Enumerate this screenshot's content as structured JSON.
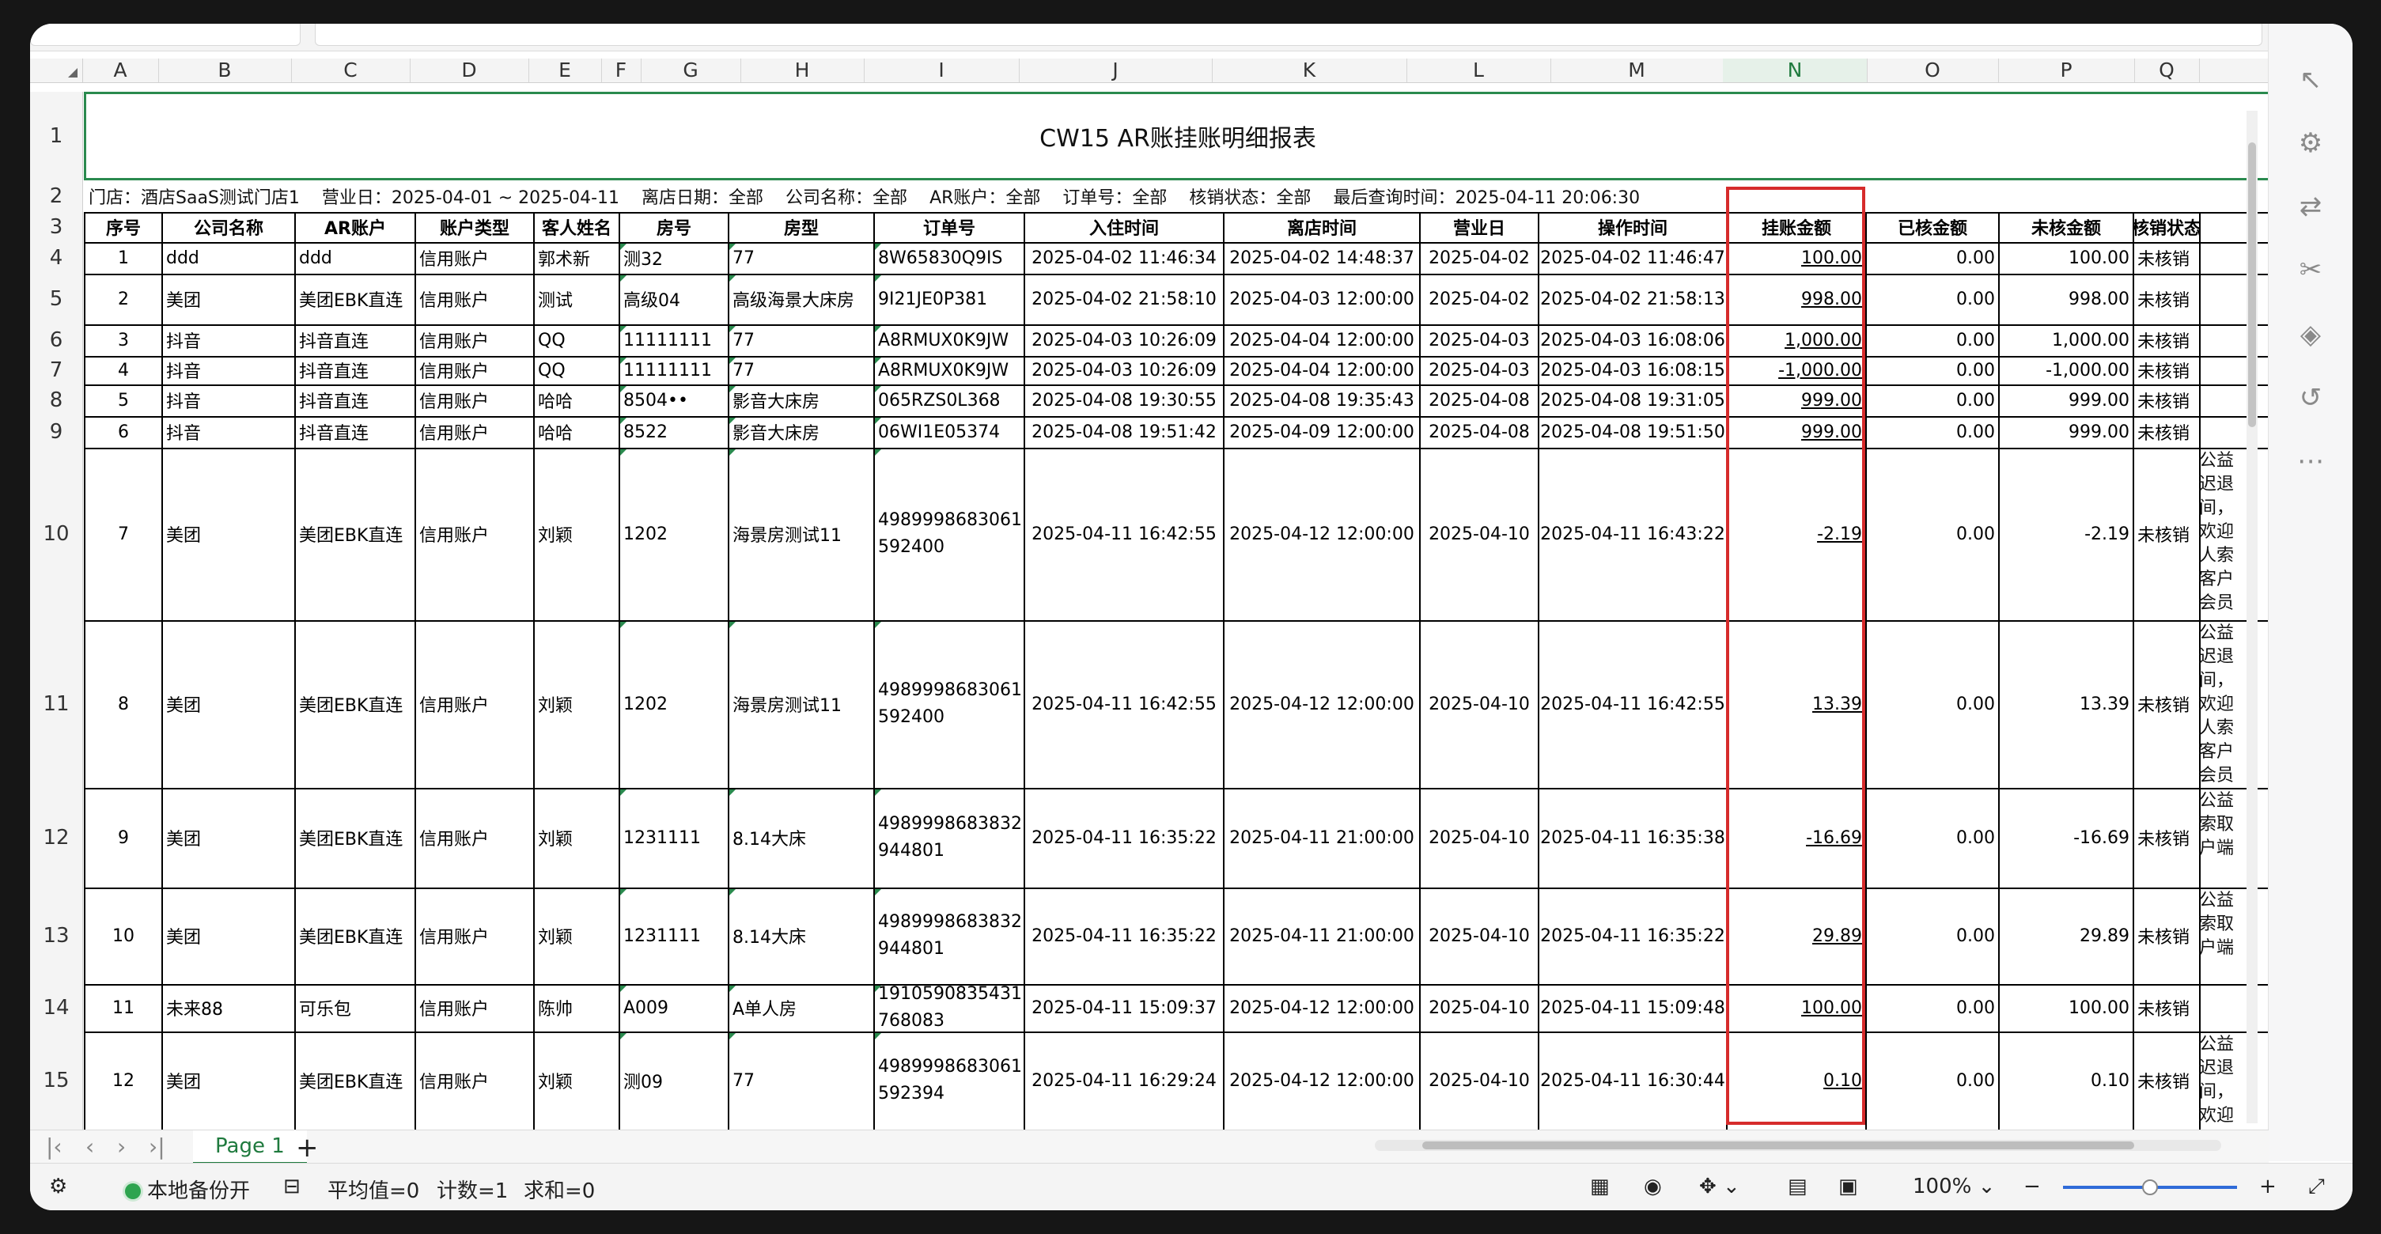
{
  "report_title": "CW15 AR账挂账明细报表",
  "meta": {
    "store": "门店：酒店SaaS测试门店1",
    "business_date": "营业日：2025-04-01 ~ 2025-04-11",
    "checkout_date": "离店日期：全部",
    "company": "公司名称：全部",
    "ar_account": "AR账户：全部",
    "order_no": "订单号：全部",
    "status": "核销状态：全部",
    "last_query": "最后查询时间：2025-04-11 20:06:30"
  },
  "columns": [
    "A",
    "B",
    "C",
    "D",
    "E",
    "F",
    "G",
    "H",
    "I",
    "J",
    "K",
    "L",
    "M",
    "N",
    "O",
    "P",
    "Q"
  ],
  "headers": [
    "序号",
    "公司名称",
    "AR账户",
    "账户类型",
    "客人姓名",
    "房号",
    "房型",
    "订单号",
    "入住时间",
    "离店时间",
    "营业日",
    "操作时间",
    "挂账金额",
    "已核金额",
    "未核金额",
    "核销状态"
  ],
  "rows": [
    {
      "n": "4",
      "seq": "1",
      "company": "ddd",
      "ar": "ddd",
      "type": "信用账户",
      "guest": "郭术新",
      "room": "测32",
      "roomtype": "77",
      "order": "8W65830Q9IS",
      "order2": "",
      "checkin": "2025-04-02 11:46:34",
      "checkout": "2025-04-02 14:48:37",
      "bizday": "2025-04-02",
      "optime": "2025-04-02 11:46:47",
      "amount": "100.00",
      "verified": "0.00",
      "unverified": "100.00",
      "state": "未核销",
      "note": ""
    },
    {
      "n": "5",
      "seq": "2",
      "company": "美团",
      "ar": "美团EBK直连",
      "type": "信用账户",
      "guest": "测试",
      "room": "高级04",
      "roomtype": "高级海景大床房",
      "order": "9I21JE0P381",
      "order2": "",
      "checkin": "2025-04-02 21:58:10",
      "checkout": "2025-04-03 12:00:00",
      "bizday": "2025-04-02",
      "optime": "2025-04-02 21:58:13",
      "amount": "998.00",
      "verified": "0.00",
      "unverified": "998.00",
      "state": "未核销",
      "note": ""
    },
    {
      "n": "6",
      "seq": "3",
      "company": "抖音",
      "ar": "抖音直连",
      "type": "信用账户",
      "guest": "QQ",
      "room": "11111111",
      "roomtype": "77",
      "order": "A8RMUX0K9JW",
      "order2": "",
      "checkin": "2025-04-03 10:26:09",
      "checkout": "2025-04-04 12:00:00",
      "bizday": "2025-04-03",
      "optime": "2025-04-03 16:08:06",
      "amount": "1,000.00",
      "verified": "0.00",
      "unverified": "1,000.00",
      "state": "未核销",
      "note": ""
    },
    {
      "n": "7",
      "seq": "4",
      "company": "抖音",
      "ar": "抖音直连",
      "type": "信用账户",
      "guest": "QQ",
      "room": "11111111",
      "roomtype": "77",
      "order": "A8RMUX0K9JW",
      "order2": "",
      "checkin": "2025-04-03 10:26:09",
      "checkout": "2025-04-04 12:00:00",
      "bizday": "2025-04-03",
      "optime": "2025-04-03 16:08:15",
      "amount": "-1,000.00",
      "verified": "0.00",
      "unverified": "-1,000.00",
      "state": "未核销",
      "note": ""
    },
    {
      "n": "8",
      "seq": "5",
      "company": "抖音",
      "ar": "抖音直连",
      "type": "信用账户",
      "guest": "哈哈",
      "room": "8504••",
      "roomtype": "影音大床房",
      "order": "065RZS0L368",
      "order2": "",
      "checkin": "2025-04-08 19:30:55",
      "checkout": "2025-04-08 19:35:43",
      "bizday": "2025-04-08",
      "optime": "2025-04-08 19:31:05",
      "amount": "999.00",
      "verified": "0.00",
      "unverified": "999.00",
      "state": "未核销",
      "note": ""
    },
    {
      "n": "9",
      "seq": "6",
      "company": "抖音",
      "ar": "抖音直连",
      "type": "信用账户",
      "guest": "哈哈",
      "room": "8522",
      "roomtype": "影音大床房",
      "order": "06WI1E05374",
      "order2": "",
      "checkin": "2025-04-08 19:51:42",
      "checkout": "2025-04-09 12:00:00",
      "bizday": "2025-04-08",
      "optime": "2025-04-08 19:51:50",
      "amount": "999.00",
      "verified": "0.00",
      "unverified": "999.00",
      "state": "未核销",
      "note": ""
    },
    {
      "n": "10",
      "seq": "7",
      "company": "美团",
      "ar": "美团EBK直连",
      "type": "信用账户",
      "guest": "刘颖",
      "room": "1202",
      "roomtype": "海景房测试11",
      "order": "4989998683061",
      "order2": "592400",
      "checkin": "2025-04-11 16:42:55",
      "checkout": "2025-04-12 12:00:00",
      "bizday": "2025-04-10",
      "optime": "2025-04-11 16:43:22",
      "amount": "-2.19",
      "verified": "0.00",
      "unverified": "-2.19",
      "state": "未核销",
      "note": "公益\n迟退\n间，\n欢迎\n人索\n客户\n会员"
    },
    {
      "n": "11",
      "seq": "8",
      "company": "美团",
      "ar": "美团EBK直连",
      "type": "信用账户",
      "guest": "刘颖",
      "room": "1202",
      "roomtype": "海景房测试11",
      "order": "4989998683061",
      "order2": "592400",
      "checkin": "2025-04-11 16:42:55",
      "checkout": "2025-04-12 12:00:00",
      "bizday": "2025-04-10",
      "optime": "2025-04-11 16:42:55",
      "amount": "13.39",
      "verified": "0.00",
      "unverified": "13.39",
      "state": "未核销",
      "note": "公益\n迟退\n间，\n欢迎\n人索\n客户\n会员"
    },
    {
      "n": "12",
      "seq": "9",
      "company": "美团",
      "ar": "美团EBK直连",
      "type": "信用账户",
      "guest": "刘颖",
      "room": "1231111",
      "roomtype": "8.14大床",
      "order": "4989998683832",
      "order2": "944801",
      "checkin": "2025-04-11 16:35:22",
      "checkout": "2025-04-11 21:00:00",
      "bizday": "2025-04-10",
      "optime": "2025-04-11 16:35:38",
      "amount": "-16.69",
      "verified": "0.00",
      "unverified": "-16.69",
      "state": "未核销",
      "note": "公益\n索取\n户端"
    },
    {
      "n": "13",
      "seq": "10",
      "company": "美团",
      "ar": "美团EBK直连",
      "type": "信用账户",
      "guest": "刘颖",
      "room": "1231111",
      "roomtype": "8.14大床",
      "order": "4989998683832",
      "order2": "944801",
      "checkin": "2025-04-11 16:35:22",
      "checkout": "2025-04-11 21:00:00",
      "bizday": "2025-04-10",
      "optime": "2025-04-11 16:35:22",
      "amount": "29.89",
      "verified": "0.00",
      "unverified": "29.89",
      "state": "未核销",
      "note": "公益\n索取\n户端"
    },
    {
      "n": "14",
      "seq": "11",
      "company": "未来88",
      "ar": "可乐包",
      "type": "信用账户",
      "guest": "陈帅",
      "room": "A009",
      "roomtype": "A单人房",
      "order": "1910590835431",
      "order2": "768083",
      "checkin": "2025-04-11 15:09:37",
      "checkout": "2025-04-12 12:00:00",
      "bizday": "2025-04-10",
      "optime": "2025-04-11 15:09:48",
      "amount": "100.00",
      "verified": "0.00",
      "unverified": "100.00",
      "state": "未核销",
      "note": ""
    },
    {
      "n": "15",
      "seq": "12",
      "company": "美团",
      "ar": "美团EBK直连",
      "type": "信用账户",
      "guest": "刘颖",
      "room": "测09",
      "roomtype": "77",
      "order": "4989998683061",
      "order2": "592394",
      "checkin": "2025-04-11 16:29:24",
      "checkout": "2025-04-12 12:00:00",
      "bizday": "2025-04-10",
      "optime": "2025-04-11 16:30:44",
      "amount": "0.10",
      "verified": "0.00",
      "unverified": "0.10",
      "state": "未核销",
      "note": "公益\n迟退\n间，\n欢迎\n人索"
    }
  ],
  "row_labels": {
    "r1": "1",
    "r2": "2",
    "r3": "3"
  },
  "tabs": {
    "sheet": "Page 1",
    "add": "+"
  },
  "status": {
    "backup": "本地备份开",
    "avg": "平均值=0",
    "count": "计数=1",
    "sum": "求和=0",
    "zoom": "100%",
    "zoom_minus": "−",
    "zoom_plus": "+"
  },
  "colors": {
    "accent": "#1f7a3e",
    "selection": "#d62b2b"
  }
}
